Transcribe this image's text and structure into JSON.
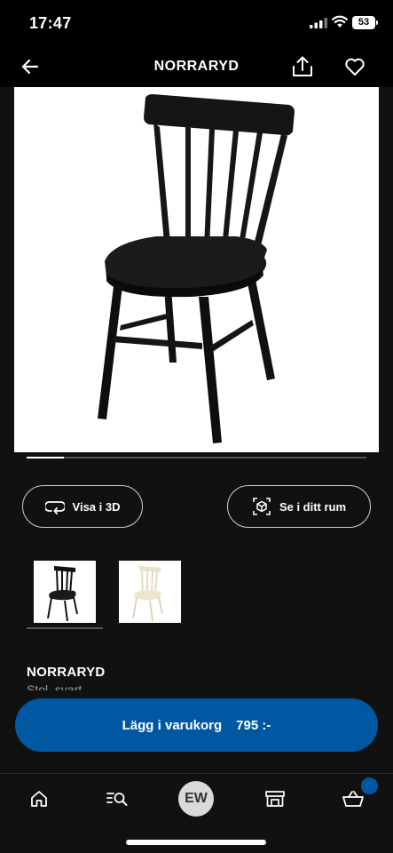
{
  "status": {
    "time": "17:47",
    "battery": "53"
  },
  "nav": {
    "title": "NORRARYD"
  },
  "actions": {
    "view_3d": "Visa i 3D",
    "view_in_room": "Se i ditt rum"
  },
  "product": {
    "name": "NORRARYD",
    "description": "Stol, svart",
    "variants": [
      "black",
      "white"
    ]
  },
  "cart": {
    "label": "Lägg i varukorg",
    "price": "795 :-"
  },
  "tabbar": {
    "account_initials": "EW"
  },
  "colors": {
    "accent": "#0058a3",
    "background": "#111111"
  },
  "icons": [
    "back-icon",
    "share-icon",
    "heart-icon",
    "rotate-3d-icon",
    "ar-cube-icon",
    "home-icon",
    "search-list-icon",
    "store-icon",
    "basket-icon"
  ]
}
